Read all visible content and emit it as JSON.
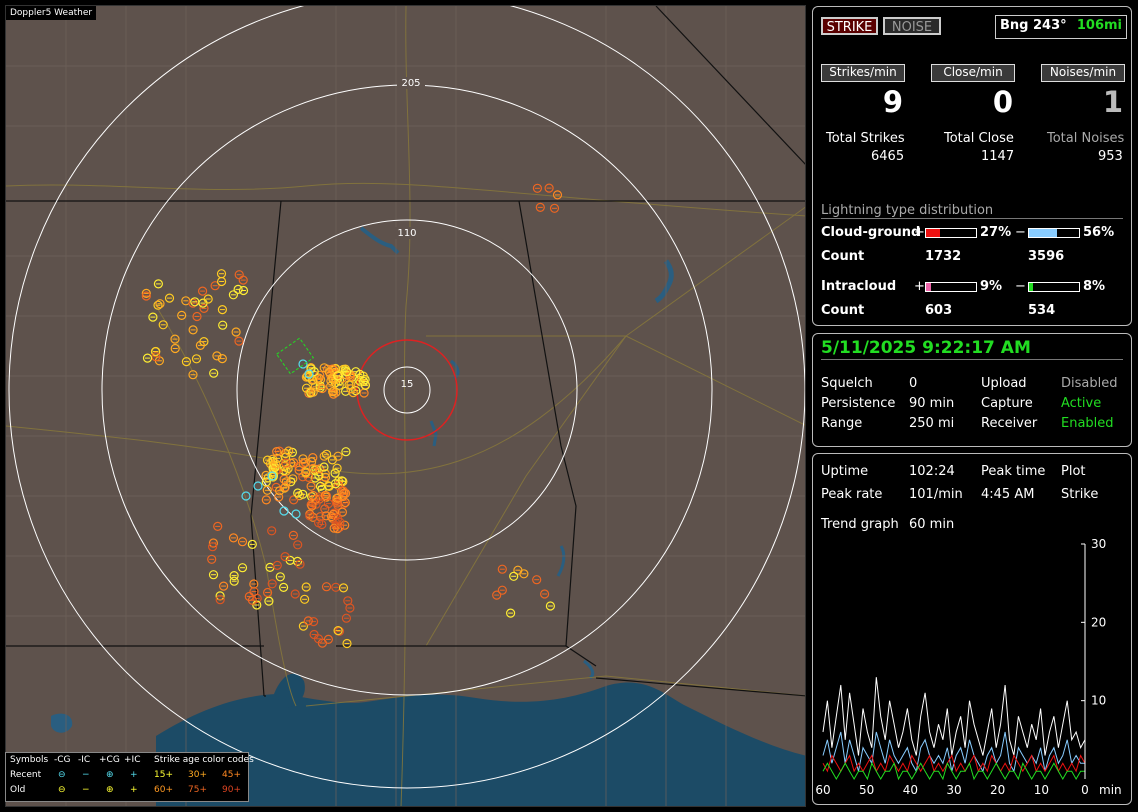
{
  "map": {
    "title": "Doppler5 Weather",
    "ring_labels": [
      "205",
      "110",
      "15"
    ]
  },
  "legend": {
    "header_symbols": "Symbols",
    "header_cg_neg": "-CG",
    "header_ic_neg": "-IC",
    "header_cg_pos": "+CG",
    "header_ic_pos": "+IC",
    "header_age": "Strike age color codes",
    "recent": "Recent",
    "old": "Old",
    "recent_ages": [
      "15+",
      "30+",
      "45+"
    ],
    "old_ages": [
      "60+",
      "75+",
      "90+"
    ]
  },
  "status": {
    "strike_button": "STRIKE",
    "noise_button": "NOISE",
    "bearing": "Bng 243°",
    "distance": "106mi",
    "strikes_per_min_label": "Strikes/min",
    "close_per_min_label": "Close/min",
    "noises_per_min_label": "Noises/min",
    "strikes_per_min": "9",
    "close_per_min": "0",
    "noises_per_min": "1",
    "total_strikes_label": "Total Strikes",
    "total_close_label": "Total Close",
    "total_noises_label": "Total Noises",
    "total_strikes": "6465",
    "total_close": "1147",
    "total_noises": "953"
  },
  "distribution": {
    "title": "Lightning type distribution",
    "cg_label": "Cloud-ground",
    "ic_label": "Intracloud",
    "count_label": "Count",
    "plus": "+",
    "minus": "−",
    "cg_pos_pct": "27%",
    "cg_neg_pct": "56%",
    "ic_pos_pct": "9%",
    "ic_neg_pct": "8%",
    "cg_pos_count": "1732",
    "cg_neg_count": "3596",
    "ic_pos_count": "603",
    "ic_neg_count": "534",
    "cg_pos_fill": 0.27,
    "cg_neg_fill": 0.56,
    "ic_pos_fill": 0.09,
    "ic_neg_fill": 0.08,
    "colors": {
      "cg_pos": "#ee1111",
      "cg_neg": "#88ccff",
      "ic_pos": "#ee66aa",
      "ic_neg": "#22dd22"
    }
  },
  "system": {
    "datetime": "5/11/2025 9:22:17 AM",
    "squelch_label": "Squelch",
    "squelch": "0",
    "persistence_label": "Persistence",
    "persistence": "90 min",
    "range_label": "Range",
    "range": "250 mi",
    "upload_label": "Upload",
    "upload": "Disabled",
    "capture_label": "Capture",
    "capture": "Active",
    "receiver_label": "Receiver",
    "receiver": "Enabled"
  },
  "stats": {
    "uptime_label": "Uptime",
    "uptime": "102:24",
    "peak_time_label": "Peak time",
    "peak_time": "4:45 AM",
    "plot_label": "Plot",
    "plot": "Strike",
    "peak_rate_label": "Peak rate",
    "peak_rate": "101/min",
    "trend_label": "Trend graph",
    "trend": "60 min"
  },
  "chart_data": {
    "type": "line",
    "x": [
      60,
      50,
      40,
      30,
      20,
      10,
      0
    ],
    "xlabel": "min",
    "ylim": [
      0,
      30
    ],
    "yticks": [
      10,
      20,
      30
    ],
    "series": [
      {
        "color": "#ffffff",
        "values": [
          6,
          10,
          4,
          8,
          12,
          5,
          11,
          7,
          3,
          9,
          6,
          4,
          13,
          8,
          5,
          10,
          7,
          4,
          6,
          9,
          5,
          3,
          8,
          11,
          6,
          4,
          7,
          5,
          9,
          3,
          6,
          8,
          4,
          10,
          7,
          5,
          3,
          6,
          9,
          4,
          7,
          12,
          5,
          3,
          8,
          6,
          4,
          7,
          5,
          9,
          3,
          6,
          8,
          4,
          7,
          10,
          5,
          6,
          4,
          5
        ]
      },
      {
        "color": "#88ccff",
        "values": [
          3,
          5,
          2,
          4,
          6,
          2,
          5,
          3,
          1,
          4,
          3,
          2,
          6,
          4,
          2,
          5,
          3,
          2,
          3,
          4,
          2,
          1,
          4,
          5,
          3,
          2,
          3,
          2,
          4,
          1,
          3,
          4,
          2,
          5,
          3,
          2,
          1,
          3,
          4,
          2,
          3,
          6,
          2,
          1,
          4,
          3,
          2,
          3,
          2,
          4,
          1,
          3,
          4,
          2,
          3,
          5,
          2,
          3,
          2,
          2
        ]
      },
      {
        "color": "#ee1111",
        "values": [
          2,
          1,
          3,
          2,
          1,
          2,
          3,
          1,
          2,
          1,
          2,
          3,
          1,
          2,
          1,
          3,
          2,
          1,
          2,
          1,
          3,
          2,
          1,
          2,
          3,
          1,
          2,
          1,
          2,
          3,
          1,
          2,
          1,
          2,
          3,
          1,
          2,
          1,
          3,
          2,
          1,
          2,
          1,
          3,
          2,
          1,
          2,
          3,
          1,
          2,
          1,
          2,
          3,
          1,
          2,
          1,
          2,
          1,
          3,
          2
        ]
      },
      {
        "color": "#22dd22",
        "values": [
          1,
          2,
          1,
          0,
          1,
          2,
          1,
          0,
          1,
          1,
          0,
          2,
          1,
          0,
          1,
          1,
          2,
          0,
          1,
          1,
          0,
          1,
          2,
          1,
          0,
          1,
          1,
          0,
          2,
          1,
          0,
          1,
          1,
          2,
          0,
          1,
          1,
          0,
          1,
          2,
          1,
          0,
          1,
          1,
          0,
          2,
          1,
          0,
          1,
          1,
          0,
          1,
          2,
          1,
          0,
          1,
          1,
          0,
          1,
          1
        ]
      }
    ]
  }
}
